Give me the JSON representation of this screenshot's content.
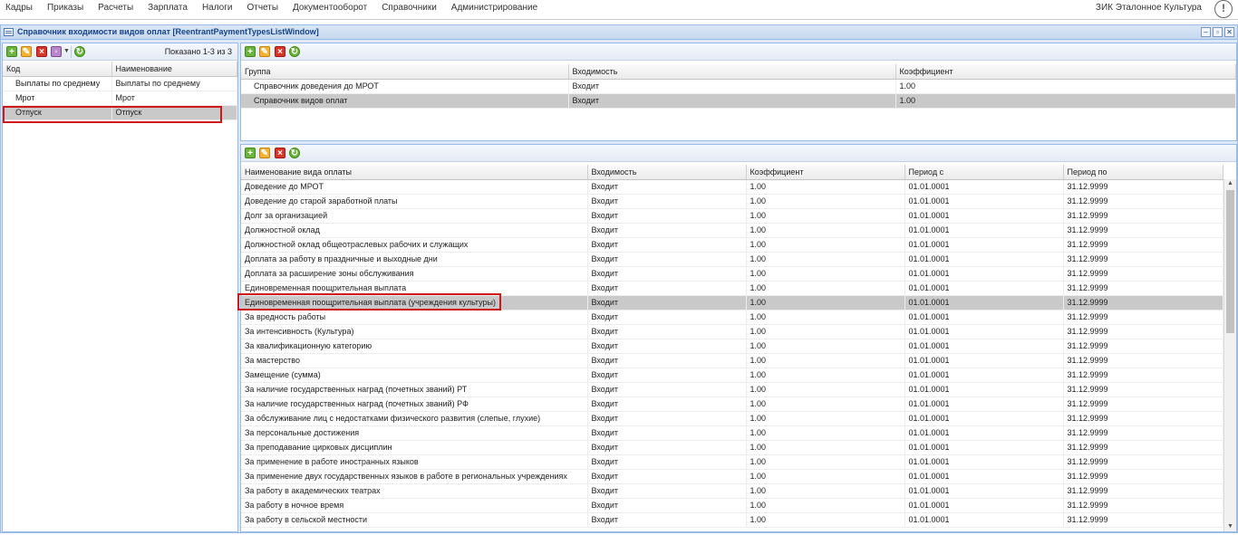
{
  "menu": [
    "Кадры",
    "Приказы",
    "Расчеты",
    "Зарплата",
    "Налоги",
    "Отчеты",
    "Документооборот",
    "Справочники",
    "Администрирование"
  ],
  "org_name": "ЗИК Эталонное Культура",
  "alert_glyph": "!",
  "window": {
    "title": "Справочник входимости видов оплат [ReentrantPaymentTypesListWindow]",
    "btn_minimize": "–",
    "btn_restore": "▫",
    "btn_close": "✕"
  },
  "left_panel": {
    "count_label": "Показано 1-3 из 3",
    "columns": [
      "Код",
      "Наименование"
    ],
    "rows": [
      [
        "Выплаты по среднему",
        "Выплаты по среднему"
      ],
      [
        "Мрот",
        "Мрот"
      ],
      [
        "Отпуск",
        "Отпуск"
      ]
    ],
    "selected_index": 2
  },
  "groups_panel": {
    "columns": [
      "Группа",
      "Входимость",
      "Коэффициент"
    ],
    "rows": [
      [
        "Справочник доведения до МРОТ",
        "Входит",
        "1.00"
      ],
      [
        "Справочник видов оплат",
        "Входит",
        "1.00"
      ]
    ],
    "selected_index": 1
  },
  "payments_panel": {
    "columns": [
      "Наименование вида оплаты",
      "Входимость",
      "Коэффициент",
      "Период с",
      "Период по"
    ],
    "rows": [
      [
        "Доведение до МРОТ",
        "Входит",
        "1.00",
        "01.01.0001",
        "31.12.9999"
      ],
      [
        "Доведение до старой заработной платы",
        "Входит",
        "1.00",
        "01.01.0001",
        "31.12.9999"
      ],
      [
        "Долг за организацией",
        "Входит",
        "1.00",
        "01.01.0001",
        "31.12.9999"
      ],
      [
        "Должностной оклад",
        "Входит",
        "1.00",
        "01.01.0001",
        "31.12.9999"
      ],
      [
        "Должностной оклад общеотраслевых рабочих и служащих",
        "Входит",
        "1.00",
        "01.01.0001",
        "31.12.9999"
      ],
      [
        "Доплата за работу в праздничные и выходные дни",
        "Входит",
        "1.00",
        "01.01.0001",
        "31.12.9999"
      ],
      [
        "Доплата за расширение зоны обслуживания",
        "Входит",
        "1.00",
        "01.01.0001",
        "31.12.9999"
      ],
      [
        "Единовременная поощрительная выплата",
        "Входит",
        "1.00",
        "01.01.0001",
        "31.12.9999"
      ],
      [
        "Единовременная поощрительная выплата (учреждения культуры)",
        "Входит",
        "1.00",
        "01.01.0001",
        "31.12.9999"
      ],
      [
        "За вредность работы",
        "Входит",
        "1.00",
        "01.01.0001",
        "31.12.9999"
      ],
      [
        "За интенсивность (Культура)",
        "Входит",
        "1.00",
        "01.01.0001",
        "31.12.9999"
      ],
      [
        "За квалификационную категорию",
        "Входит",
        "1.00",
        "01.01.0001",
        "31.12.9999"
      ],
      [
        "За мастерство",
        "Входит",
        "1.00",
        "01.01.0001",
        "31.12.9999"
      ],
      [
        "Замещение (сумма)",
        "Входит",
        "1.00",
        "01.01.0001",
        "31.12.9999"
      ],
      [
        "За наличие государственных наград (почетных званий) РТ",
        "Входит",
        "1.00",
        "01.01.0001",
        "31.12.9999"
      ],
      [
        "За наличие государственных наград (почетных званий) РФ",
        "Входит",
        "1.00",
        "01.01.0001",
        "31.12.9999"
      ],
      [
        "За обслуживание лиц с недостатками физического развития (слепые, глухие)",
        "Входит",
        "1.00",
        "01.01.0001",
        "31.12.9999"
      ],
      [
        "За персональные достижения",
        "Входит",
        "1.00",
        "01.01.0001",
        "31.12.9999"
      ],
      [
        "За преподавание цирковых дисциплин",
        "Входит",
        "1.00",
        "01.01.0001",
        "31.12.9999"
      ],
      [
        "За применение в работе иностранных языков",
        "Входит",
        "1.00",
        "01.01.0001",
        "31.12.9999"
      ],
      [
        "За применение двух государственных языков в работе в региональных учреждениях",
        "Входит",
        "1.00",
        "01.01.0001",
        "31.12.9999"
      ],
      [
        "За работу в академических театрах",
        "Входит",
        "1.00",
        "01.01.0001",
        "31.12.9999"
      ],
      [
        "За работу в ночное время",
        "Входит",
        "1.00",
        "01.01.0001",
        "31.12.9999"
      ],
      [
        "За работу в сельской местности",
        "Входит",
        "1.00",
        "01.01.0001",
        "31.12.9999"
      ]
    ],
    "selected_index": 8
  },
  "toolbar_icons": [
    "add-icon",
    "edit-icon",
    "delete-icon",
    "refresh-icon"
  ],
  "colors": {
    "highlight_border": "#d01818",
    "selected_row": "#c9c9c9",
    "window_border": "#99bbe8"
  }
}
